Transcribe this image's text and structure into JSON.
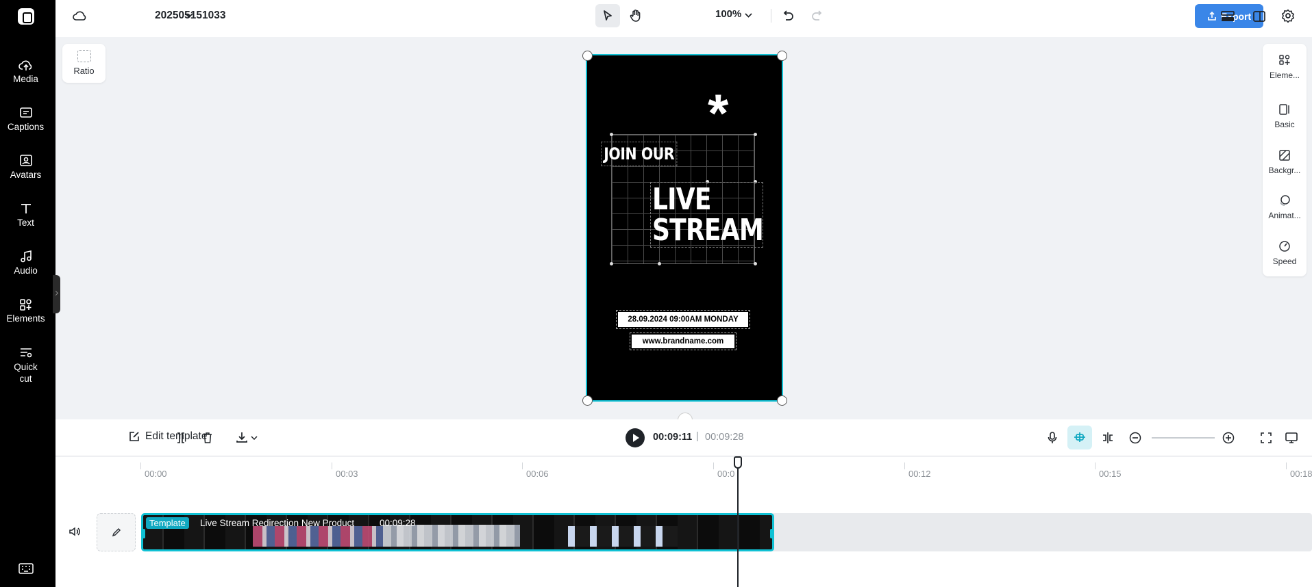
{
  "app": {
    "project_name": "202505151033",
    "zoom": "100%",
    "export_label": "Export",
    "accent_color": "#3a86e8",
    "selection_color": "#10c1d4"
  },
  "sidebar": {
    "items": [
      {
        "label": "Media",
        "icon": "cloud-upload-icon"
      },
      {
        "label": "Captions",
        "icon": "captions-icon"
      },
      {
        "label": "Avatars",
        "icon": "avatar-icon"
      },
      {
        "label": "Text",
        "icon": "text-icon"
      },
      {
        "label": "Audio",
        "icon": "music-note-icon"
      },
      {
        "label": "Elements",
        "icon": "elements-icon"
      },
      {
        "label": "Quick cut",
        "icon": "quick-cut-icon"
      }
    ]
  },
  "canvas": {
    "ratio_label": "Ratio",
    "video": {
      "heading_small": "JOIN OUR",
      "heading_big_line1": "LIVE",
      "heading_big_line2": "STREAM",
      "asterisk": "*",
      "date_text": "28.09.2024 09:00AM MONDAY",
      "url_text": "www.brandname.com"
    }
  },
  "right_panel": {
    "items": [
      {
        "label": "Eleme...",
        "icon": "elements-icon"
      },
      {
        "label": "Basic",
        "icon": "basic-icon"
      },
      {
        "label": "Backgr...",
        "icon": "background-icon"
      },
      {
        "label": "Animat...",
        "icon": "animation-icon"
      },
      {
        "label": "Speed",
        "icon": "speed-icon"
      }
    ]
  },
  "timeline_toolbar": {
    "edit_template_label": "Edit template",
    "current_time": "00:09:11",
    "separator": "|",
    "total_time": "00:09:28"
  },
  "timeline": {
    "ticks": [
      "00:00",
      "00:03",
      "00:06",
      "00:0",
      "00:12",
      "00:15",
      "00:18"
    ],
    "clip": {
      "tag": "Template",
      "title": "Live Stream Redirection New Product",
      "duration": "00:09:28"
    }
  }
}
